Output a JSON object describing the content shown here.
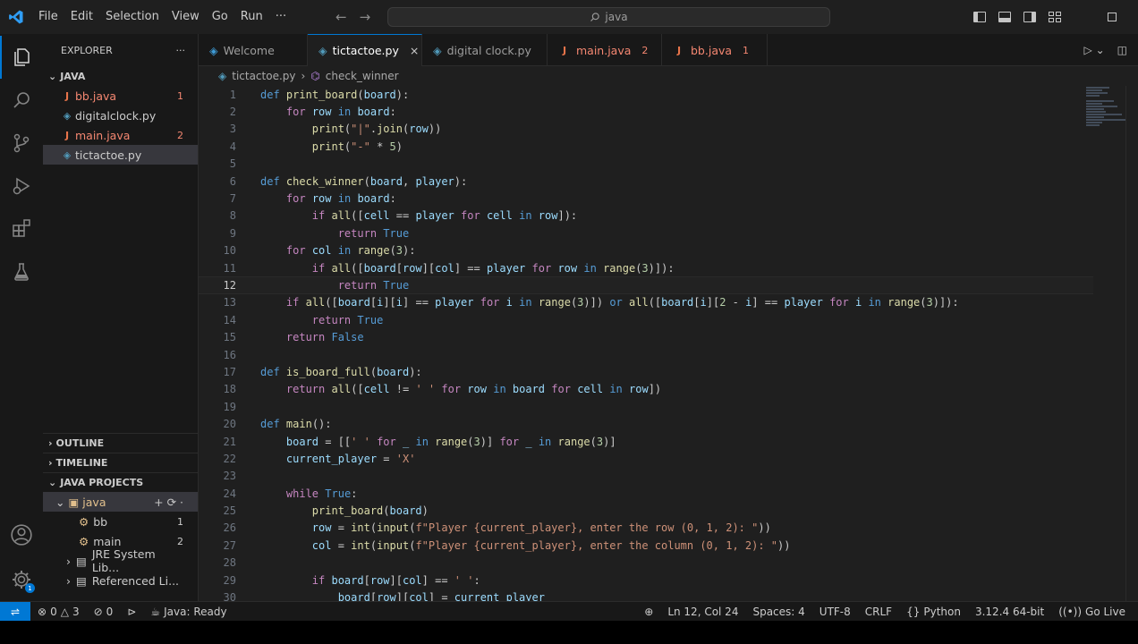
{
  "menu": [
    "File",
    "Edit",
    "Selection",
    "View",
    "Go",
    "Run",
    "···"
  ],
  "search": {
    "text": "java"
  },
  "sidebar": {
    "title": "EXPLORER",
    "more": "···",
    "folder": "JAVA",
    "files": [
      {
        "icon": "J",
        "name": "bb.java",
        "badge": "1",
        "kind": "java"
      },
      {
        "icon": "◈",
        "name": "digitalclock.py",
        "badge": "",
        "kind": "py"
      },
      {
        "icon": "J",
        "name": "main.java",
        "badge": "2",
        "kind": "java"
      },
      {
        "icon": "◈",
        "name": "tictactoe.py",
        "badge": "",
        "kind": "py"
      }
    ],
    "outline": "OUTLINE",
    "timeline": "TIMELINE",
    "java_projects": "JAVA PROJECTS",
    "project": "java",
    "project_items": [
      {
        "name": "bb",
        "badge": "1"
      },
      {
        "name": "main",
        "badge": "2"
      }
    ],
    "libs": [
      "JRE System Lib...",
      "Referenced Li..."
    ]
  },
  "tabs": [
    {
      "label": "Welcome",
      "icon": "◈",
      "badge": ""
    },
    {
      "label": "tictactoe.py",
      "icon": "◈",
      "badge": "",
      "active": true,
      "close": "×"
    },
    {
      "label": "digital clock.py",
      "icon": "◈",
      "badge": ""
    },
    {
      "label": "main.java",
      "icon": "J",
      "badge": "2"
    },
    {
      "label": "bb.java",
      "icon": "J",
      "badge": "1"
    }
  ],
  "breadcrumb": {
    "file": "tictactoe.py",
    "symbol": "check_winner"
  },
  "code": {
    "current_line": 12,
    "lines": [
      "def print_board(board):",
      "    for row in board:",
      "        print(\"|\".join(row))",
      "        print(\"-\" * 5)",
      "",
      "def check_winner(board, player):",
      "    for row in board:",
      "        if all([cell == player for cell in row]):",
      "            return True",
      "    for col in range(3):",
      "        if all([board[row][col] == player for row in range(3)]):",
      "            return True",
      "    if all([board[i][i] == player for i in range(3)]) or all([board[i][2 - i] == player for i in range(3)]):",
      "        return True",
      "    return False",
      "",
      "def is_board_full(board):",
      "    return all([cell != ' ' for row in board for cell in row])",
      "",
      "def main():",
      "    board = [[' ' for _ in range(3)] for _ in range(3)]",
      "    current_player = 'X'",
      "",
      "    while True:",
      "        print_board(board)",
      "        row = int(input(f\"Player {current_player}, enter the row (0, 1, 2): \"))",
      "        col = int(input(f\"Player {current_player}, enter the column (0, 1, 2): \"))",
      "",
      "        if board[row][col] == ' ':",
      "            board[row][col] = current_player"
    ]
  },
  "status": {
    "errors": "0",
    "warnings": "3",
    "ports": "0",
    "java": "Java: Ready",
    "position": "Ln 12, Col 24",
    "spaces": "Spaces: 4",
    "encoding": "UTF-8",
    "eol": "CRLF",
    "language": "Python",
    "interpreter": "3.12.4 64-bit",
    "golive": "Go Live"
  }
}
